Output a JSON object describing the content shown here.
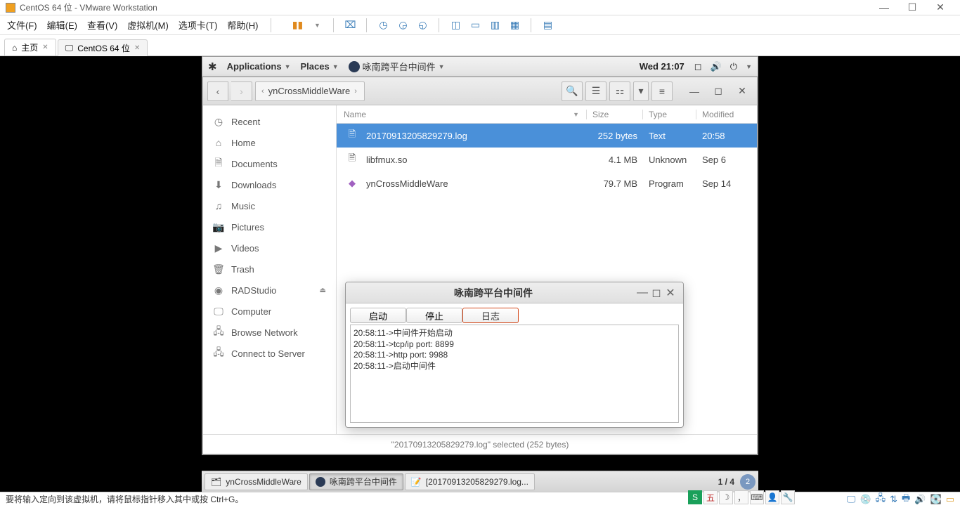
{
  "vmware": {
    "title": "CentOS 64 位 - VMware Workstation",
    "menus": [
      "文件(F)",
      "编辑(E)",
      "查看(V)",
      "虚拟机(M)",
      "选项卡(T)",
      "帮助(H)"
    ],
    "tabs": [
      {
        "label": "主页",
        "closable": true
      },
      {
        "label": "CentOS 64 位",
        "closable": true,
        "active": true
      }
    ]
  },
  "gnome": {
    "app_menu": "Applications",
    "places_menu": "Places",
    "active_app": "咏南跨平台中间件",
    "clock": "Wed 21:07",
    "bottom": {
      "tasks": [
        {
          "label": "ynCrossMiddleWare",
          "icon": "file-manager-icon"
        },
        {
          "label": "咏南跨平台中间件",
          "icon": "app-icon",
          "active": true
        },
        {
          "label": "[20170913205829279.log...",
          "icon": "editor-icon"
        }
      ],
      "workspace": "1 / 4",
      "notif_count": "2"
    }
  },
  "nautilus": {
    "path": "ynCrossMiddleWare",
    "sidebar": [
      {
        "label": "Recent",
        "icon": "clock-icon"
      },
      {
        "label": "Home",
        "icon": "home-icon"
      },
      {
        "label": "Documents",
        "icon": "document-icon"
      },
      {
        "label": "Downloads",
        "icon": "download-icon"
      },
      {
        "label": "Music",
        "icon": "music-icon"
      },
      {
        "label": "Pictures",
        "icon": "camera-icon"
      },
      {
        "label": "Videos",
        "icon": "video-icon"
      },
      {
        "label": "Trash",
        "icon": "trash-icon"
      },
      {
        "label": "RADStudio",
        "icon": "disc-icon",
        "eject": true
      },
      {
        "label": "Computer",
        "icon": "computer-icon"
      },
      {
        "label": "Browse Network",
        "icon": "network-icon"
      },
      {
        "label": "Connect to Server",
        "icon": "server-icon"
      }
    ],
    "columns": {
      "name": "Name",
      "size": "Size",
      "type": "Type",
      "modified": "Modified"
    },
    "files": [
      {
        "name": "20170913205829279.log",
        "size": "252 bytes",
        "type": "Text",
        "modified": "20:58",
        "selected": true,
        "icon": "text"
      },
      {
        "name": "libfmux.so",
        "size": "4.1 MB",
        "type": "Unknown",
        "modified": "Sep 6",
        "icon": "text"
      },
      {
        "name": "ynCrossMiddleWare",
        "size": "79.7 MB",
        "type": "Program",
        "modified": "Sep 14",
        "icon": "exec"
      }
    ],
    "status": "\"20170913205829279.log\" selected  (252 bytes)"
  },
  "app": {
    "title": "咏南跨平台中间件",
    "tabs": {
      "start": "启动",
      "stop": "停止",
      "log": "日志"
    },
    "log_lines": [
      "20:58:11->中间件开始启动",
      "20:58:11->tcp/ip port: 8899",
      "20:58:11->http port: 9988",
      "20:58:11->启动中间件"
    ]
  },
  "host": {
    "status": "要将输入定向到该虚拟机，请将鼠标指针移入其中或按 Ctrl+G。",
    "ime": "五"
  }
}
